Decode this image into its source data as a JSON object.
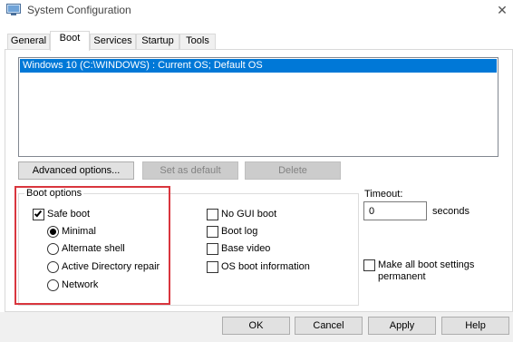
{
  "window": {
    "title": "System Configuration",
    "close_glyph": "✕"
  },
  "tabs": [
    {
      "label": "General"
    },
    {
      "label": "Boot"
    },
    {
      "label": "Services"
    },
    {
      "label": "Startup"
    },
    {
      "label": "Tools"
    }
  ],
  "os_list": {
    "items": [
      "Windows 10 (C:\\WINDOWS) : Current OS; Default OS"
    ],
    "selected_index": 0
  },
  "list_buttons": {
    "advanced": "Advanced options...",
    "set_default": "Set as default",
    "delete": "Delete"
  },
  "boot_options": {
    "legend": "Boot options",
    "safe_boot": {
      "label": "Safe boot",
      "checked": true
    },
    "radios": [
      {
        "label": "Minimal",
        "selected": true
      },
      {
        "label": "Alternate shell",
        "selected": false
      },
      {
        "label": "Active Directory repair",
        "selected": false
      },
      {
        "label": "Network",
        "selected": false
      }
    ],
    "checks": [
      {
        "label": "No GUI boot",
        "checked": false
      },
      {
        "label": "Boot log",
        "checked": false
      },
      {
        "label": "Base video",
        "checked": false
      },
      {
        "label": "OS boot information",
        "checked": false
      }
    ]
  },
  "timeout": {
    "label": "Timeout:",
    "value": "0",
    "unit": "seconds"
  },
  "make_permanent": {
    "line1": "Make all boot settings",
    "line2": "permanent",
    "checked": false
  },
  "dialog_buttons": {
    "ok": "OK",
    "cancel": "Cancel",
    "apply": "Apply",
    "help": "Help"
  },
  "colors": {
    "selection": "#0078d7",
    "highlight_box": "#d9363e"
  }
}
